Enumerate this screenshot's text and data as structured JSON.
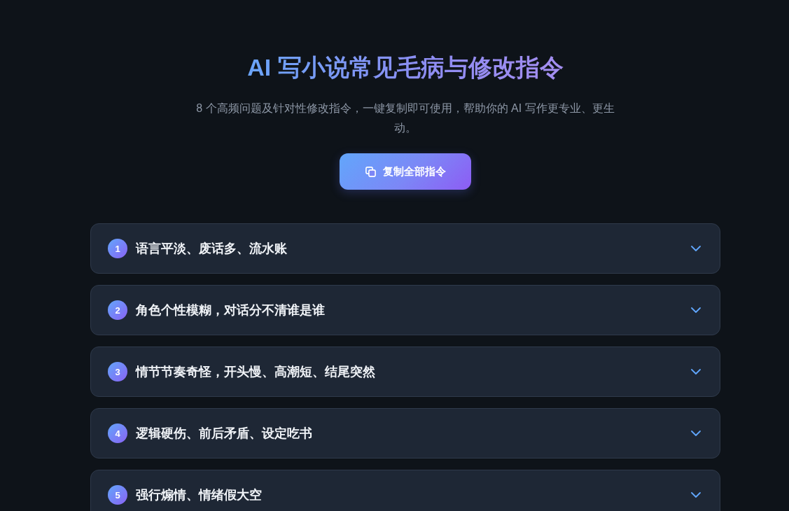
{
  "header": {
    "title": "AI 写小说常见毛病与修改指令",
    "subtitle": "8 个高频问题及针对性修改指令，一键复制即可使用，帮助你的 AI 写作更专业、更生动。"
  },
  "copy_all_button": {
    "label": "复制全部指令"
  },
  "problems": [
    {
      "number": "1",
      "title": "语言平淡、废话多、流水账",
      "expanded": false
    },
    {
      "number": "2",
      "title": "角色个性模糊，对话分不清谁是谁",
      "expanded": false
    },
    {
      "number": "3",
      "title": "情节节奏奇怪，开头慢、高潮短、结尾突然",
      "expanded": false
    },
    {
      "number": "4",
      "title": "逻辑硬伤、前后矛盾、设定吃书",
      "expanded": false
    },
    {
      "number": "5",
      "title": "强行煽情、情绪假大空",
      "expanded": false
    }
  ]
}
